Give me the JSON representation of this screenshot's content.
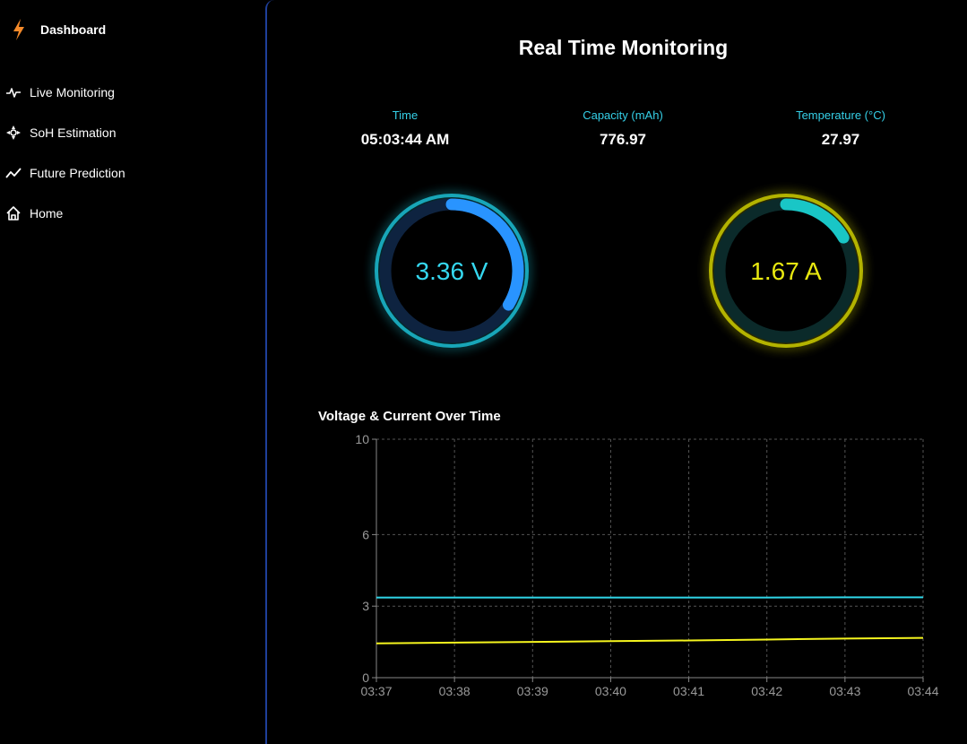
{
  "sidebar": {
    "brand": {
      "label": "Dashboard",
      "icon": "bolt-icon",
      "color": "#f58a2a"
    },
    "items": [
      {
        "label": "Live Monitoring",
        "icon": "pulse-icon"
      },
      {
        "label": "SoH Estimation",
        "icon": "compass-icon"
      },
      {
        "label": "Future Prediction",
        "icon": "trend-icon"
      },
      {
        "label": "Home",
        "icon": "home-icon"
      }
    ]
  },
  "main": {
    "title": "Real Time Monitoring",
    "stats": [
      {
        "label": "Time",
        "value": "05:03:44 AM"
      },
      {
        "label": "Capacity (mAh)",
        "value": "776.97"
      },
      {
        "label": "Temperature (°C)",
        "value": "27.97"
      }
    ],
    "gauges": [
      {
        "text": "3.36 V",
        "fraction": 0.336,
        "color": "#2994ff",
        "glow": "#1ed0e6",
        "text_color": "#35d8f0"
      },
      {
        "text": "1.67 A",
        "fraction": 0.167,
        "color": "#19c6c6",
        "glow": "#e0e000",
        "text_color": "#e8e810"
      }
    ]
  },
  "chart_data": {
    "type": "line",
    "title": "Voltage & Current Over Time",
    "categories": [
      "03:37",
      "03:38",
      "03:39",
      "03:40",
      "03:41",
      "03:42",
      "03:43",
      "03:44"
    ],
    "yticks": [
      0,
      3,
      6,
      10
    ],
    "ylim": [
      0,
      10
    ],
    "grid": true,
    "series": [
      {
        "values": [
          3.36,
          3.36,
          3.36,
          3.36,
          3.36,
          3.36,
          3.37,
          3.37
        ],
        "color": "#2fd6e8"
      },
      {
        "values": [
          1.44,
          1.47,
          1.5,
          1.53,
          1.56,
          1.6,
          1.64,
          1.67
        ],
        "color": "#f5f51e"
      }
    ]
  }
}
